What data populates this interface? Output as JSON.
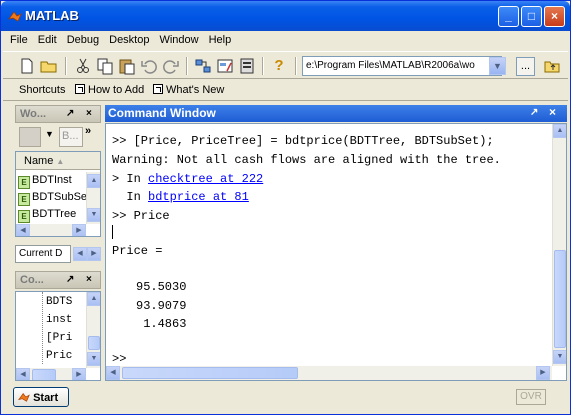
{
  "window": {
    "title": "MATLAB",
    "minimize": "_",
    "maximize": "□",
    "close": "×"
  },
  "menu": [
    "File",
    "Edit",
    "Debug",
    "Desktop",
    "Window",
    "Help"
  ],
  "toolbar": {
    "current_directory": "e:\\Program Files\\MATLAB\\R2006a\\wo",
    "browse_label": "...",
    "help_glyph": "?"
  },
  "shortcuts": {
    "label": "Shortcuts",
    "items": [
      "How to Add",
      "What's New"
    ]
  },
  "workspace": {
    "title": "Wo...",
    "pin": "↗",
    "close": "×",
    "column_header": "Name",
    "sort_arrow": "▲",
    "items": [
      "BDTInst",
      "BDTSubSet",
      "BDTTree"
    ],
    "tab_label": "Current D"
  },
  "history": {
    "title": "Co...",
    "pin": "↗",
    "close": "×",
    "lines": [
      "BDTS",
      "inst",
      "[Pri",
      "Pric"
    ]
  },
  "command_window": {
    "title": "Command Window",
    "pin": "↗",
    "close": "×",
    "lines": {
      "l1": ">> [Price, PriceTree] = bdtprice(BDTTree, BDTSubSet);",
      "l2": "Warning: Not all cash flows are aligned with the tree.",
      "l3_prefix": "> In ",
      "l3_link": "checktree at 222",
      "l4_prefix": "  In ",
      "l4_link": "bdtprice at 81",
      "l5": ">> Price",
      "l6": "Price =",
      "v1": "95.5030",
      "v2": "93.9079",
      "v3": " 1.4863",
      "prompt": ">>"
    }
  },
  "status": {
    "start_label": "Start",
    "ovr": "OVR"
  }
}
